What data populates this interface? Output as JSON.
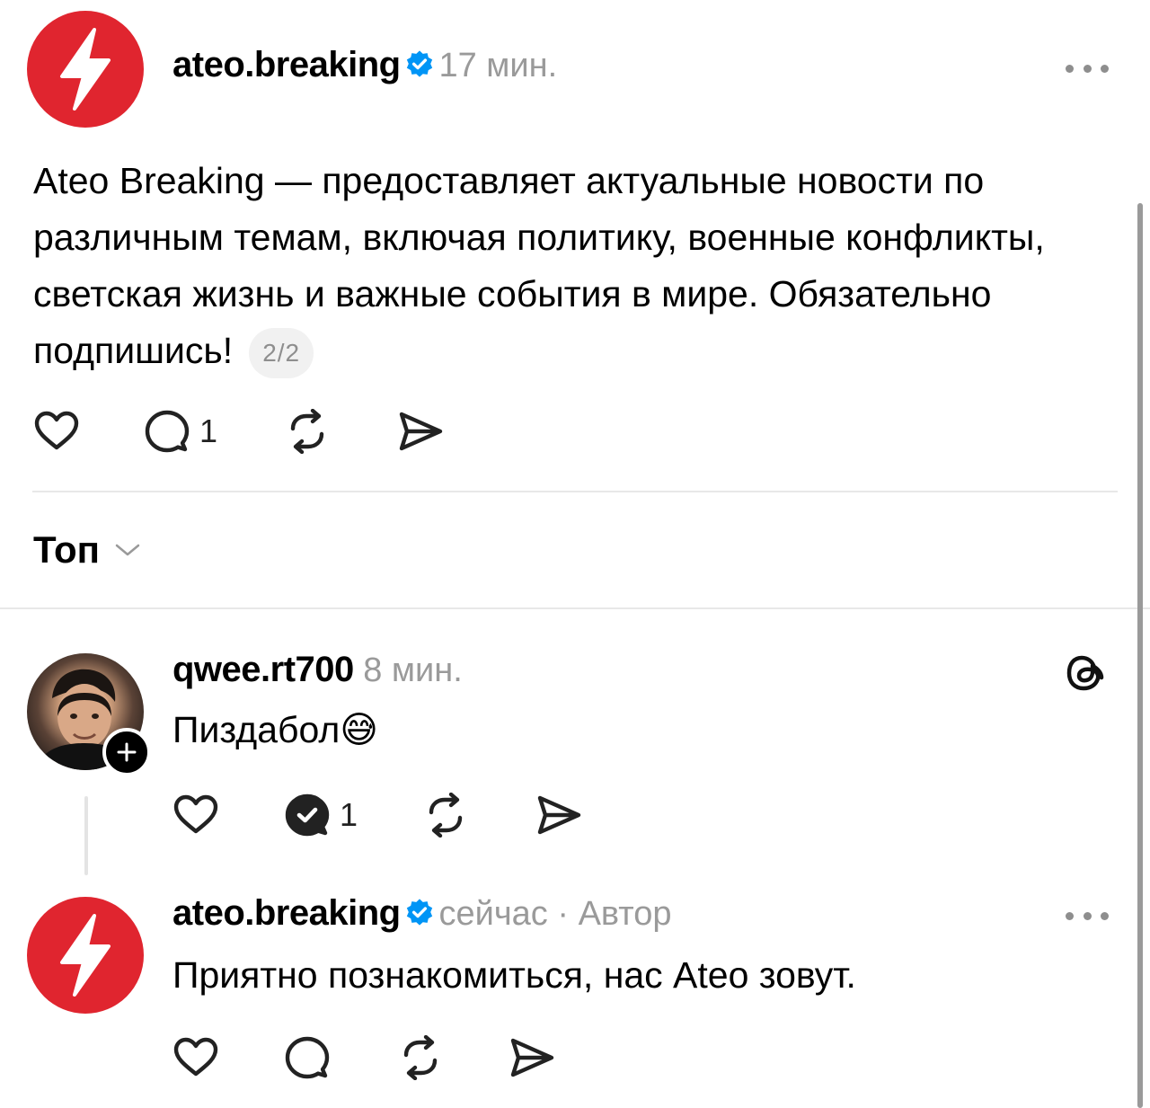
{
  "post": {
    "username": "ateo.breaking",
    "time": "17 мин.",
    "text": "Ateo Breaking — предоставляет актуальные новости по различным темам, включая политику, военные конфликты, светская жизнь и важные события в мире. Обязательно подпишись!",
    "pager": "2/2",
    "reply_count": "1"
  },
  "sort": {
    "label": "Топ"
  },
  "replies": [
    {
      "username": "qwee.rt700",
      "time": "8 мин.",
      "text": "Пиздабол😅",
      "reply_count": "1"
    },
    {
      "username": "ateo.breaking",
      "time": "сейчас",
      "separator": " · ",
      "author_tag": "Автор",
      "text": "Приятно познакомиться, нас Ateo зовут."
    }
  ],
  "colors": {
    "brand": "#e0252f",
    "verified": "#0095f6",
    "meta": "#9a9a9a"
  }
}
